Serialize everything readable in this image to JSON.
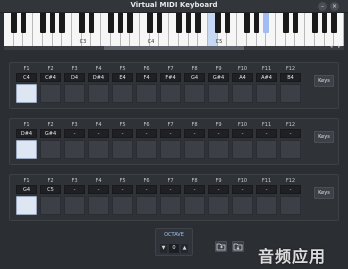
{
  "window": {
    "title": "Virtual MIDI Keyboard",
    "minimize_glyph": "–",
    "close_glyph": "×"
  },
  "keyboard": {
    "octave_labels": [
      "C3",
      "C4",
      "C5"
    ],
    "highlight_color": "#c7d8f5",
    "scroll_left": "◂",
    "scroll_right": "▸"
  },
  "rows": [
    {
      "function_keys": [
        "F1",
        "F2",
        "F3",
        "F4",
        "F5",
        "F6",
        "F7",
        "F8",
        "F9",
        "F10",
        "F11",
        "F12"
      ],
      "notes": [
        "C4",
        "C#4",
        "D4",
        "D#4",
        "E4",
        "F4",
        "F#4",
        "G4",
        "G#4",
        "A4",
        "A#4",
        "B4"
      ],
      "active_pad": 0,
      "button_label": "Keys"
    },
    {
      "function_keys": [
        "F1",
        "F2",
        "F3",
        "F4",
        "F5",
        "F6",
        "F7",
        "F8",
        "F9",
        "F10",
        "F11",
        "F12"
      ],
      "notes": [
        "D#4",
        "G#4",
        "-",
        "-",
        "-",
        "-",
        "-",
        "-",
        "-",
        "-",
        "-",
        "-"
      ],
      "active_pad": 0,
      "button_label": "Keys"
    },
    {
      "function_keys": [
        "F1",
        "F2",
        "F3",
        "F4",
        "F5",
        "F6",
        "F7",
        "F8",
        "F9",
        "F10",
        "F11",
        "F12"
      ],
      "notes": [
        "G4",
        "C5",
        "-",
        "-",
        "-",
        "-",
        "-",
        "-",
        "-",
        "-",
        "-",
        "-"
      ],
      "active_pad": 0,
      "button_label": "Keys"
    }
  ],
  "octave": {
    "label": "OCTAVE",
    "value": "0",
    "down": "▼",
    "up": "▲"
  },
  "toolbar": {
    "open_icon": "folder-open-icon",
    "save_icon": "folder-save-icon"
  },
  "watermark": "音频应用"
}
